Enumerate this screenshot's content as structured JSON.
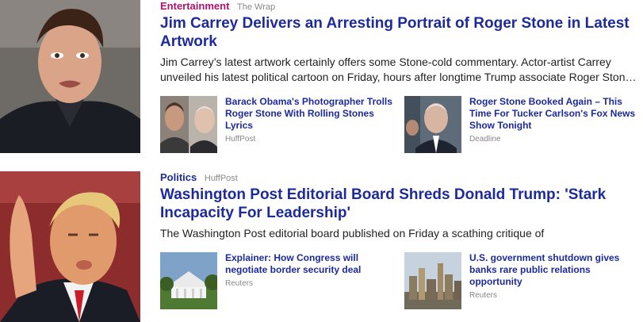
{
  "stories": [
    {
      "category": "Entertainment",
      "category_color": "#b0136f",
      "source": "The Wrap",
      "headline": "Jim Carrey Delivers an Arresting Portrait of Roger Stone in Latest Artwork",
      "summary": "Jim Carrey’s latest artwork certainly offers some Stone-cold commentary. Actor-artist Carrey unveiled his latest political cartoon on Friday, hours after longtime Trump associate Roger Ston…",
      "related": [
        {
          "title": "Barack Obama's Photographer Trolls Roger Stone With Rolling Stones Lyrics",
          "source": "HuffPost"
        },
        {
          "title": "Roger Stone Booked Again – This Time For Tucker Carlson's Fox News Show Tonight",
          "source": "Deadline"
        }
      ]
    },
    {
      "category": "Politics",
      "category_color": "#1d2a9c",
      "source": "HuffPost",
      "headline": "Washington Post Editorial Board Shreds Donald Trump: 'Stark Incapacity For Leadership'",
      "summary": "The Washington Post editorial board published on Friday a scathing critique of",
      "related": [
        {
          "title": "Explainer: How Congress will negotiate border security deal",
          "source": "Reuters"
        },
        {
          "title": "U.S. government shutdown gives banks rare public relations opportunity",
          "source": "Reuters"
        }
      ]
    }
  ],
  "colors": {
    "headline": "#1d2a9c",
    "source": "#888888"
  }
}
